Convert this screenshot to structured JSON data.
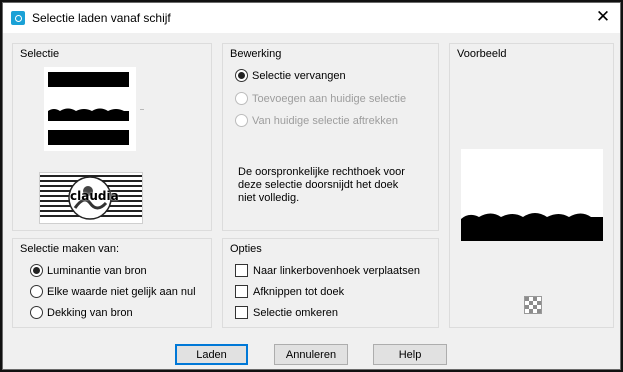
{
  "window": {
    "title": "Selectie laden vanaf schijf",
    "close_label": "✕"
  },
  "selectie": {
    "title": "Selectie",
    "watermark_text": "claudia"
  },
  "bewerking": {
    "title": "Bewerking",
    "options": [
      {
        "label": "Selectie vervangen",
        "checked": true,
        "enabled": true
      },
      {
        "label": "Toevoegen aan huidige selectie",
        "checked": false,
        "enabled": false
      },
      {
        "label": "Van huidige selectie aftrekken",
        "checked": false,
        "enabled": false
      }
    ],
    "description_line1": "De oorspronkelijke rechthoek voor",
    "description_line2": "deze selectie doorsnijdt het doek",
    "description_line3": "niet volledig."
  },
  "voorbeeld": {
    "title": "Voorbeeld"
  },
  "selectie_maken": {
    "title": "Selectie maken van:",
    "options": [
      {
        "label": "Luminantie van bron",
        "checked": true
      },
      {
        "label": "Elke waarde niet gelijk aan nul",
        "checked": false
      },
      {
        "label": "Dekking van bron",
        "checked": false
      }
    ]
  },
  "opties": {
    "title": "Opties",
    "checkboxes": [
      {
        "label": "Naar linkerbovenhoek verplaatsen",
        "checked": false
      },
      {
        "label": "Afknippen tot doek",
        "checked": false
      },
      {
        "label": "Selectie omkeren",
        "checked": false
      }
    ]
  },
  "buttons": {
    "load": "Laden",
    "cancel": "Annuleren",
    "help": "Help"
  },
  "colors": {
    "accent": "#0078d7",
    "dialog_bg": "#f0f0f0",
    "group_border": "#dcdcdc",
    "disabled_text": "#9d9d9d"
  }
}
